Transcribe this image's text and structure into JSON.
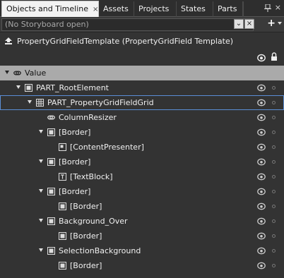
{
  "tabs": {
    "items": [
      {
        "label": "Objects and Timeline",
        "active": true
      },
      {
        "label": "Assets"
      },
      {
        "label": "Projects"
      },
      {
        "label": "States"
      },
      {
        "label": "Parts"
      }
    ],
    "close_glyph": "×",
    "panel_close_glyph": "×"
  },
  "storyboard": {
    "text": "(No Storyboard open)",
    "dropdown_glyph": "⌄",
    "close_glyph": "×",
    "add_glyph": "+"
  },
  "scope": {
    "title": "PropertyGridFieldTemplate (PropertyGridField Template)",
    "icon": "template-scope-up-icon"
  },
  "tree": {
    "rows": [
      {
        "label": "Value",
        "icon": "link-icon",
        "expanded": true
      },
      {
        "label": "PART_RootElement",
        "icon": "grid-element-icon",
        "expanded": true
      },
      {
        "label": "PART_PropertyGridFieldGrid",
        "icon": "grid-layout-icon",
        "expanded": true,
        "selected": true
      },
      {
        "label": "ColumnResizer",
        "icon": "link-icon"
      },
      {
        "label": "[Border]",
        "icon": "border-icon",
        "expanded": true
      },
      {
        "label": "[ContentPresenter]",
        "icon": "content-presenter-icon"
      },
      {
        "label": "[Border]",
        "icon": "border-icon",
        "expanded": true
      },
      {
        "label": "[TextBlock]",
        "icon": "textblock-icon"
      },
      {
        "label": "[Border]",
        "icon": "border-icon",
        "expanded": true
      },
      {
        "label": "[Border]",
        "icon": "border-icon"
      },
      {
        "label": "Background_Over",
        "icon": "border-icon",
        "expanded": true
      },
      {
        "label": "[Border]",
        "icon": "border-icon"
      },
      {
        "label": "SelectionBackground",
        "icon": "border-icon",
        "expanded": true
      },
      {
        "label": "[Border]",
        "icon": "border-icon"
      }
    ]
  }
}
